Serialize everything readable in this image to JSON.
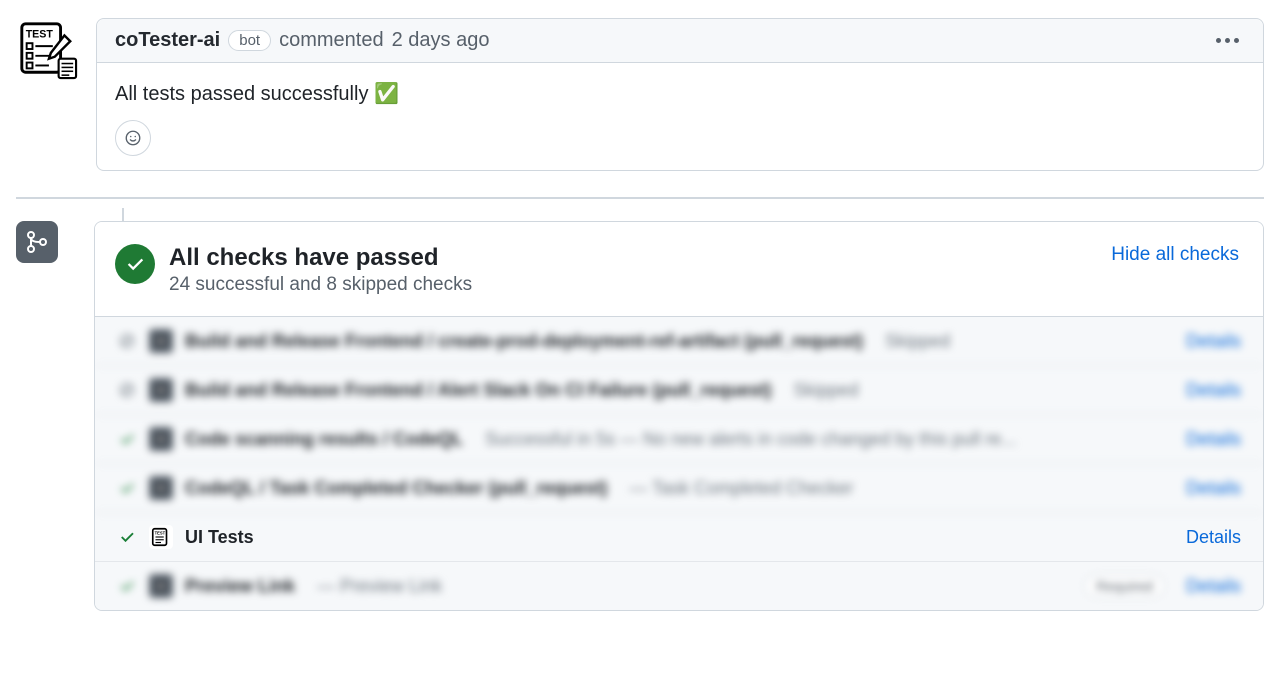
{
  "comment": {
    "author": "coTester-ai",
    "badge": "bot",
    "timestamp_prefix": "commented",
    "timestamp": "2 days ago",
    "body": "All tests passed successfully ✅"
  },
  "checks": {
    "title": "All checks have passed",
    "subtitle": "24 successful and 8 skipped checks",
    "toggle_link": "Hide all checks",
    "details_label": "Details",
    "required_label": "Required",
    "items": [
      {
        "status": "skipped",
        "name": "Build and Release Frontend / create-prod-deployment-ref-artifact (pull_request)",
        "meta": "Skipped",
        "blurred": true
      },
      {
        "status": "skipped",
        "name": "Build and Release Frontend / Alert Slack On CI Failure (pull_request)",
        "meta": "Skipped",
        "blurred": true
      },
      {
        "status": "success",
        "name": "Code scanning results / CodeQL",
        "meta": "Successful in 5s — No new alerts in code changed by this pull re...",
        "blurred": true
      },
      {
        "status": "success",
        "name": "CodeQL / Task Completed Checker (pull_request)",
        "meta": "— Task Completed Checker",
        "blurred": true
      },
      {
        "status": "success",
        "name": "UI Tests",
        "meta": "",
        "avatar": "cotester",
        "blurred": false
      },
      {
        "status": "success",
        "name": "Preview Link",
        "meta": "— Preview Link",
        "blurred": true,
        "required": true
      }
    ]
  }
}
